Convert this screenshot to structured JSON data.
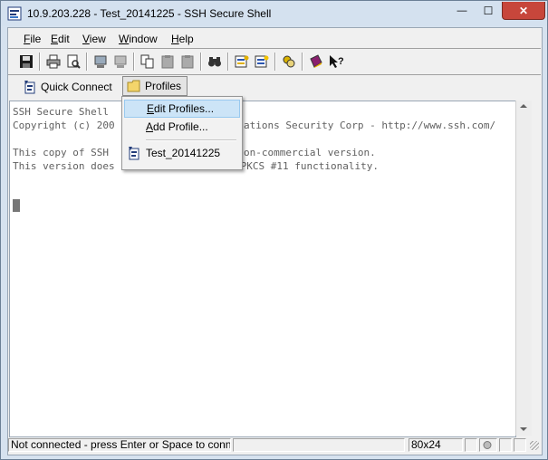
{
  "window": {
    "title": "10.9.203.228 - Test_20141225 - SSH Secure Shell",
    "minimize_glyph": "—",
    "maximize_glyph": "☐",
    "close_glyph": "✕"
  },
  "menubar": {
    "items": [
      {
        "label": "File",
        "key": "F",
        "rest": "ile"
      },
      {
        "label": "Edit",
        "key": "E",
        "rest": "dit"
      },
      {
        "label": "View",
        "key": "V",
        "rest": "iew"
      },
      {
        "label": "Window",
        "key": "W",
        "rest": "indow"
      },
      {
        "label": "Help",
        "key": "H",
        "rest": "elp"
      }
    ]
  },
  "toolbar": {
    "icons": [
      "save-icon",
      "print-icon",
      "print-preview-icon",
      "new-terminal-icon",
      "new-file-transfer-icon",
      "copy-icon",
      "paste-icon",
      "paste-alt-icon",
      "find-icon",
      "settings-icon",
      "profile-settings-icon",
      "keys-icon",
      "help-book-icon",
      "context-help-icon"
    ]
  },
  "quickbar": {
    "quick_connect": "Quick Connect",
    "profiles": "Profiles"
  },
  "terminal": {
    "lines": [
      "SSH Secure Shell",
      "Copyright (c) 200",
      "",
      "This copy of SSH",
      "This version does not include PKI and PKCS #11 functionality."
    ],
    "line2_tail": "ations Security Corp - http://www.ssh.com/",
    "line4_tail": "on-commercial version."
  },
  "profiles_menu": {
    "edit_profiles": {
      "key": "E",
      "rest": "dit Profiles..."
    },
    "add_profile": {
      "key": "A",
      "rest": "dd Profile..."
    },
    "profile_name": "Test_20141225"
  },
  "statusbar": {
    "message": "Not connected - press Enter or Space to conne",
    "size": "80x24"
  },
  "colors": {
    "title_bg": "#d4e1ef",
    "close_button": "#c7463b",
    "menu_highlight": "#cce4f7",
    "terminal_text": "#606060"
  }
}
